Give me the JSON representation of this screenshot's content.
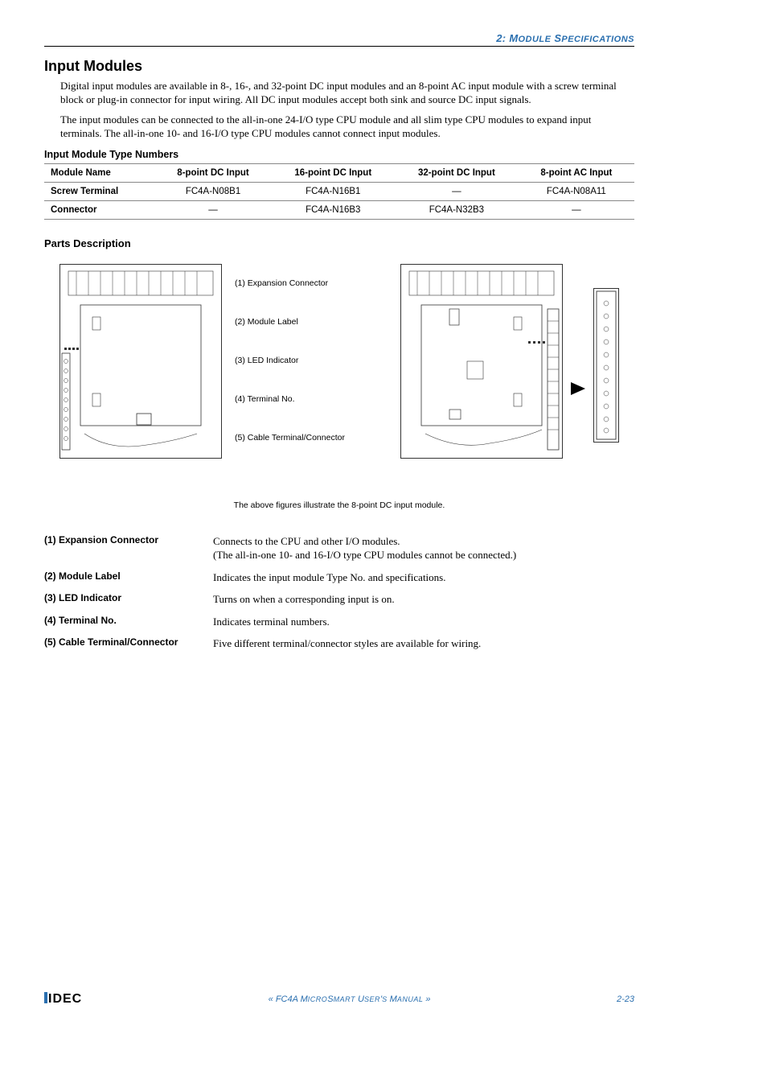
{
  "header": {
    "chapter_num": "2: M",
    "chapter_rest1": "ODULE",
    "chapter_sep": " S",
    "chapter_rest2": "PECIFICATIONS"
  },
  "section": {
    "title": "Input Modules",
    "para1": "Digital input modules are available in 8-, 16-, and 32-point DC input modules and an 8-point AC input module with a screw terminal block or plug-in connector for input wiring. All DC input modules accept both sink and source DC input signals.",
    "para2": "The input modules can be connected to the all-in-one 24-I/O type CPU module and all slim type CPU modules to expand input terminals. The all-in-one 10- and 16-I/O type CPU modules cannot connect input modules."
  },
  "table": {
    "heading": "Input Module Type Numbers",
    "cols": [
      "Module Name",
      "8-point DC Input",
      "16-point DC Input",
      "32-point DC Input",
      "8-point AC Input"
    ],
    "rows": [
      {
        "name": "Screw Terminal",
        "c1": "FC4A-N08B1",
        "c2": "FC4A-N16B1",
        "c3": "—",
        "c4": "FC4A-N08A11"
      },
      {
        "name": "Connector",
        "c1": "—",
        "c2": "FC4A-N16B3",
        "c3": "FC4A-N32B3",
        "c4": "—"
      }
    ]
  },
  "parts": {
    "heading": "Parts Description",
    "labels": {
      "l1": "(1) Expansion Connector",
      "l2": "(2) Module Label",
      "l3": "(3) LED Indicator",
      "l4": "(4) Terminal No.",
      "l5": "(5) Cable Terminal/Connector"
    },
    "caption": "The above figures illustrate the 8-point DC input module.",
    "desc": [
      {
        "label": "(1) Expansion Connector",
        "text1": "Connects to the CPU and other I/O modules.",
        "text2": "(The all-in-one 10- and 16-I/O type CPU modules cannot be connected.)"
      },
      {
        "label": "(2) Module Label",
        "text1": "Indicates the input module Type No. and specifications.",
        "text2": ""
      },
      {
        "label": "(3) LED Indicator",
        "text1": "Turns on when a corresponding input is on.",
        "text2": ""
      },
      {
        "label": "(4) Terminal No.",
        "text1": "Indicates terminal numbers.",
        "text2": ""
      },
      {
        "label": "(5) Cable Terminal/Connector",
        "text1": "Five different terminal/connector styles are available for wiring.",
        "text2": ""
      }
    ]
  },
  "footer": {
    "logo": "IDEC",
    "center_pre": "« FC4A M",
    "center_sm1": "ICRO",
    "center_mid": "S",
    "center_sm2": "MART",
    "center_post1": " U",
    "center_sm3": "SER",
    "center_post2": "'",
    "center_sm4": "S",
    "center_post3": " M",
    "center_sm5": "ANUAL",
    "center_end": " »",
    "pagenum": "2-23"
  }
}
